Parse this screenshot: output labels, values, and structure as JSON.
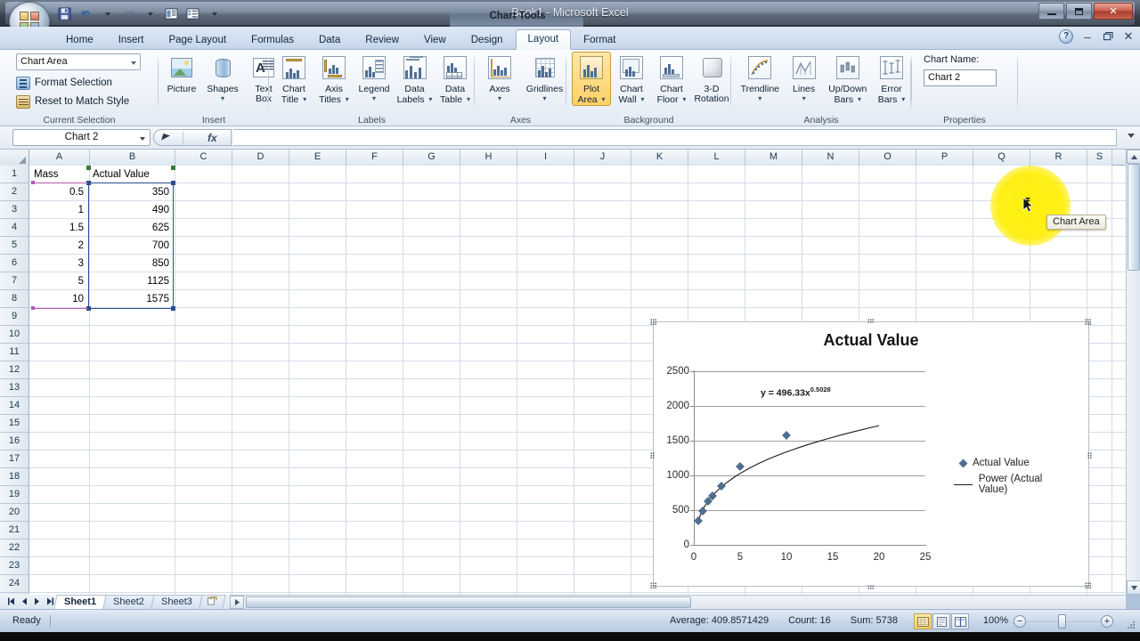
{
  "window": {
    "title": "Book1 - Microsoft Excel",
    "context_tab_group": "Chart Tools",
    "quick_access": [
      "save-icon",
      "undo-icon",
      "redo-icon",
      "print-preview-icon",
      "sort-icon"
    ],
    "controls": {
      "minimize": "–",
      "restore": "❐",
      "close": "✕",
      "help": "?"
    }
  },
  "ribbon": {
    "tabs": [
      {
        "label": "Home",
        "active": false
      },
      {
        "label": "Insert",
        "active": false
      },
      {
        "label": "Page Layout",
        "active": false
      },
      {
        "label": "Formulas",
        "active": false
      },
      {
        "label": "Data",
        "active": false
      },
      {
        "label": "Review",
        "active": false
      },
      {
        "label": "View",
        "active": false
      },
      {
        "label": "Design",
        "active": false
      },
      {
        "label": "Layout",
        "active": true
      },
      {
        "label": "Format",
        "active": false
      }
    ],
    "groups": [
      {
        "name": "Current Selection",
        "selection_value": "Chart Area",
        "items": [
          {
            "label": "Format Selection"
          },
          {
            "label": "Reset to Match Style"
          }
        ]
      },
      {
        "name": "Insert",
        "items": [
          {
            "label": "Picture",
            "dropdown": false
          },
          {
            "label": "Shapes",
            "dropdown": true
          },
          {
            "label": "Text Box",
            "dropdown": false
          }
        ]
      },
      {
        "name": "Labels",
        "items": [
          {
            "label": "Chart Title",
            "dropdown": true
          },
          {
            "label": "Axis Titles",
            "dropdown": true
          },
          {
            "label": "Legend",
            "dropdown": true
          },
          {
            "label": "Data Labels",
            "dropdown": true
          },
          {
            "label": "Data Table",
            "dropdown": true
          }
        ]
      },
      {
        "name": "Axes",
        "items": [
          {
            "label": "Axes",
            "dropdown": true
          },
          {
            "label": "Gridlines",
            "dropdown": true
          }
        ]
      },
      {
        "name": "Background",
        "items": [
          {
            "label": "Plot Area",
            "dropdown": true
          },
          {
            "label": "Chart Wall",
            "dropdown": true
          },
          {
            "label": "Chart Floor",
            "dropdown": true
          },
          {
            "label": "3-D Rotation",
            "dropdown": false
          }
        ]
      },
      {
        "name": "Analysis",
        "items": [
          {
            "label": "Trendline",
            "dropdown": true
          },
          {
            "label": "Lines",
            "dropdown": true
          },
          {
            "label": "Up/Down Bars",
            "dropdown": true
          },
          {
            "label": "Error Bars",
            "dropdown": true
          }
        ]
      },
      {
        "name": "Properties",
        "chart_name_label": "Chart Name:",
        "chart_name_value": "Chart 2"
      }
    ]
  },
  "formula_bar": {
    "name_box": "Chart 2",
    "value": "",
    "fx_label": "fx"
  },
  "grid": {
    "columns": [
      "A",
      "B",
      "C",
      "D",
      "E",
      "F",
      "G",
      "H",
      "I",
      "J",
      "K",
      "L",
      "M",
      "N",
      "O",
      "P",
      "Q",
      "R",
      "S"
    ],
    "rows": [
      1,
      2,
      3,
      4,
      5,
      6,
      7,
      8,
      9,
      10,
      11,
      12,
      13,
      14,
      15,
      16,
      17,
      18,
      19,
      20,
      21,
      22,
      23,
      24
    ],
    "headers": {
      "A": "Mass",
      "B": "Actual Value"
    },
    "data": [
      {
        "row": 2,
        "mass": "0.5",
        "value": "350"
      },
      {
        "row": 3,
        "mass": "1",
        "value": "490"
      },
      {
        "row": 4,
        "mass": "1.5",
        "value": "625"
      },
      {
        "row": 5,
        "mass": "2",
        "value": "700"
      },
      {
        "row": 6,
        "mass": "3",
        "value": "850"
      },
      {
        "row": 7,
        "mass": "5",
        "value": "1125"
      },
      {
        "row": 8,
        "mass": "10",
        "value": "1575"
      }
    ]
  },
  "chart_data": {
    "type": "scatter",
    "title": "Actual Value",
    "xlabel": "",
    "ylabel": "",
    "xlim": [
      0,
      25
    ],
    "ylim": [
      0,
      2500
    ],
    "xticks": [
      0,
      5,
      10,
      15,
      20,
      25
    ],
    "yticks": [
      0,
      500,
      1000,
      1500,
      2000,
      2500
    ],
    "grid": true,
    "legend_position": "right",
    "series": [
      {
        "name": "Actual Value",
        "type": "scatter",
        "marker": "diamond",
        "color": "#4f6d8f",
        "x": [
          0.5,
          1,
          1.5,
          2,
          3,
          5,
          10
        ],
        "y": [
          350,
          490,
          625,
          700,
          850,
          1125,
          1575
        ]
      },
      {
        "name": "Power (Actual Value)",
        "type": "trendline",
        "fit": "power",
        "color": "#1a1a1a",
        "equation": "y = 496.33x",
        "exponent": "0.5028",
        "coefficient": 496.33,
        "x_range": [
          0.5,
          20
        ]
      }
    ],
    "annotations": [
      {
        "text": "y = 496.33x",
        "superscript": "0.5028",
        "x": 5.5,
        "y": 2150
      }
    ]
  },
  "chart_object": {
    "selected": true,
    "tooltip": "Chart Area",
    "cursor": "move-cursor"
  },
  "sheet_tabs": {
    "nav": [
      "first-icon",
      "prev-icon",
      "next-icon",
      "last-icon"
    ],
    "tabs": [
      {
        "label": "Sheet1",
        "active": true
      },
      {
        "label": "Sheet2",
        "active": false
      },
      {
        "label": "Sheet3",
        "active": false
      }
    ],
    "new_sheet": "insert-worksheet-icon"
  },
  "status_bar": {
    "mode": "Ready",
    "average": "Average: 409.8571429",
    "count": "Count: 16",
    "sum": "Sum: 5738",
    "views": [
      "normal-view-icon",
      "page-layout-view-icon",
      "page-break-view-icon"
    ],
    "zoom": "100%",
    "zoom_out": "−",
    "zoom_in": "+"
  }
}
